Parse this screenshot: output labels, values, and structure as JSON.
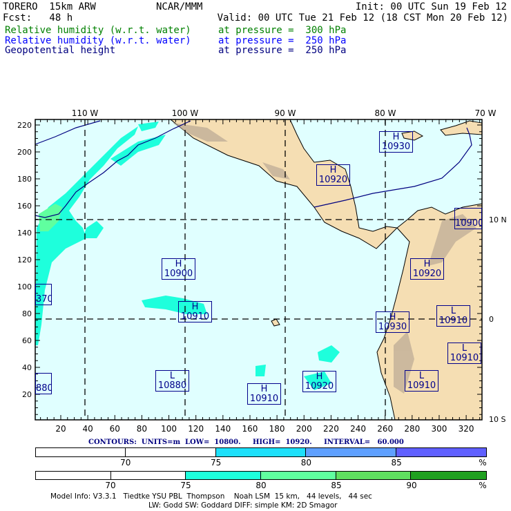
{
  "header": {
    "model": "TORERO  15km ARW",
    "org": "NCAR/MMM",
    "init": "Init: 00 UTC Sun 19 Feb 12",
    "fcst": "Fcst:   48 h",
    "valid": "Valid: 00 UTC Tue 21 Feb 12 (18 CST Mon 20 Feb 12)",
    "fields": [
      {
        "name": "Relative humidity (w.r.t. water)",
        "level": "at pressure =  300 hPa",
        "color": "#008000"
      },
      {
        "name": "Relative humidity (w.r.t. water)",
        "level": "at pressure =  250 hPa",
        "color": "#0000ff"
      },
      {
        "name": "Geopotential height",
        "level": "at pressure =  250 hPa",
        "color": "#000080"
      }
    ]
  },
  "map": {
    "background": "#e0ffff",
    "land": "#f5deb3",
    "lon_labels": [
      "110 W",
      "100 W",
      "90 W",
      "80 W",
      "70 W"
    ],
    "lat_labels": [
      "10 N",
      "0",
      "10 S"
    ],
    "y_ticks": [
      "220",
      "200",
      "180",
      "160",
      "140",
      "120",
      "100",
      "80",
      "60",
      "40",
      "20"
    ],
    "x_ticks": [
      "20",
      "40",
      "60",
      "80",
      "100",
      "120",
      "140",
      "160",
      "180",
      "200",
      "220",
      "240",
      "260",
      "280",
      "300",
      "320"
    ],
    "centers": [
      {
        "type": "H",
        "value": "10930"
      },
      {
        "type": "H",
        "value": "10920"
      },
      {
        "type": "H",
        "value": "10900"
      },
      {
        "type": "H",
        "value": "10910"
      },
      {
        "type": "H",
        "value": "10920"
      },
      {
        "type": "H",
        "value": "10930"
      },
      {
        "type": "L",
        "value": "10910"
      },
      {
        "type": "L",
        "value": "10910"
      },
      {
        "type": "L",
        "value": "10910"
      },
      {
        "type": "H",
        "value": "10920"
      },
      {
        "type": "H",
        "value": "10910"
      },
      {
        "type": "L",
        "value": "10880"
      },
      {
        "type": "",
        "value": "370"
      },
      {
        "type": "",
        "value": "880"
      },
      {
        "type": "",
        "value": "10900"
      }
    ]
  },
  "contours": "CONTOURS:  UNITS=m  LOW=  10800.     HIGH=  10920.     INTERVAL=   60.000",
  "bar250": {
    "labels": [
      "70",
      "75",
      "80",
      "85",
      "%"
    ],
    "colors": [
      "#ffffff",
      "#ffffff",
      "#1ee0fa",
      "#5fa0ff",
      "#6060ff"
    ]
  },
  "bar300": {
    "labels": [
      "70",
      "75",
      "80",
      "85",
      "90",
      "%"
    ],
    "colors": [
      "#ffffff",
      "#ffffff",
      "#1effdc",
      "#60ff9f",
      "#60e060",
      "#20a020"
    ]
  },
  "footer": {
    "line1": "Model Info: V3.3.1   Tiedtke YSU PBL  Thompson    Noah LSM  15 km,   44 levels,   44 sec",
    "line2": "LW: Godd SW: Goddard DIFF: simple KM: 2D Smagor"
  }
}
